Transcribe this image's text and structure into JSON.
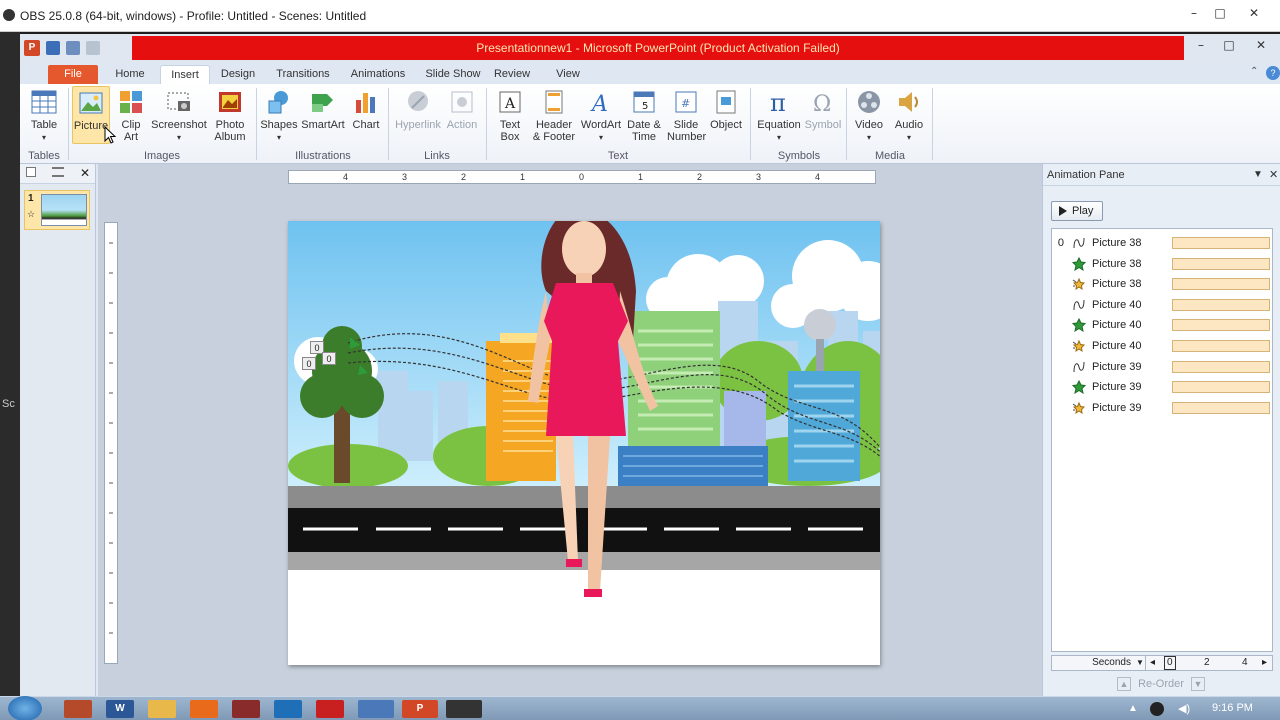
{
  "obs": {
    "title": "OBS 25.0.8 (64-bit, windows) - Profile: Untitled - Scenes: Untitled",
    "side_text": "Sc"
  },
  "ppt": {
    "title": "Presentationnew1  -  Microsoft PowerPoint (Product Activation Failed)",
    "app_icon": "P",
    "tabs": [
      "File",
      "Home",
      "Insert",
      "Design",
      "Transitions",
      "Animations",
      "Slide Show",
      "Review",
      "View"
    ],
    "active_tab": "Insert",
    "ribbon": {
      "table": "Table",
      "picture": "Picture",
      "clip_art": "Clip Art",
      "screenshot": "Screenshot",
      "photo_album": "Photo Album",
      "shapes": "Shapes",
      "smartart": "SmartArt",
      "chart": "Chart",
      "hyperlink": "Hyperlink",
      "action": "Action",
      "text_box": "Text Box",
      "header_footer": "Header & Footer",
      "wordart": "WordArt",
      "date_time": "Date & Time",
      "slide_number": "Slide Number",
      "object": "Object",
      "equation": "Equation",
      "symbol": "Symbol",
      "video": "Video",
      "audio": "Audio",
      "groups": {
        "tables": "Tables",
        "images": "Images",
        "illustrations": "Illustrations",
        "links": "Links",
        "text": "Text",
        "symbols": "Symbols",
        "media": "Media"
      }
    },
    "slide_panel": {
      "slide_number": "1"
    },
    "ruler": {
      "h_labels": [
        "4",
        "3",
        "2",
        "1",
        "0",
        "1",
        "2",
        "3",
        "4"
      ]
    },
    "slide": {
      "path_tags": [
        "0",
        "0",
        "0"
      ]
    },
    "animation_pane": {
      "title": "Animation Pane",
      "play_label": "Play",
      "items": [
        {
          "index": "0",
          "type": "path",
          "name": "Picture 38"
        },
        {
          "index": "",
          "type": "emphasis",
          "name": "Picture 38"
        },
        {
          "index": "",
          "type": "exit",
          "name": "Picture 38"
        },
        {
          "index": "",
          "type": "path",
          "name": "Picture 40"
        },
        {
          "index": "",
          "type": "emphasis",
          "name": "Picture 40"
        },
        {
          "index": "",
          "type": "exit",
          "name": "Picture 40"
        },
        {
          "index": "",
          "type": "path",
          "name": "Picture 39"
        },
        {
          "index": "",
          "type": "emphasis",
          "name": "Picture 39"
        },
        {
          "index": "",
          "type": "exit",
          "name": "Picture 39"
        }
      ],
      "seconds_label": "Seconds",
      "timeline_ticks": [
        "0",
        "2",
        "4"
      ],
      "reorder_label": "Re-Order"
    }
  },
  "taskbar": {
    "clock": "9:16 PM"
  },
  "colors": {
    "title_red": "#e60f0f",
    "file_tab": "#e5582d",
    "dress_pink": "#e8185b",
    "road": "#111111"
  }
}
